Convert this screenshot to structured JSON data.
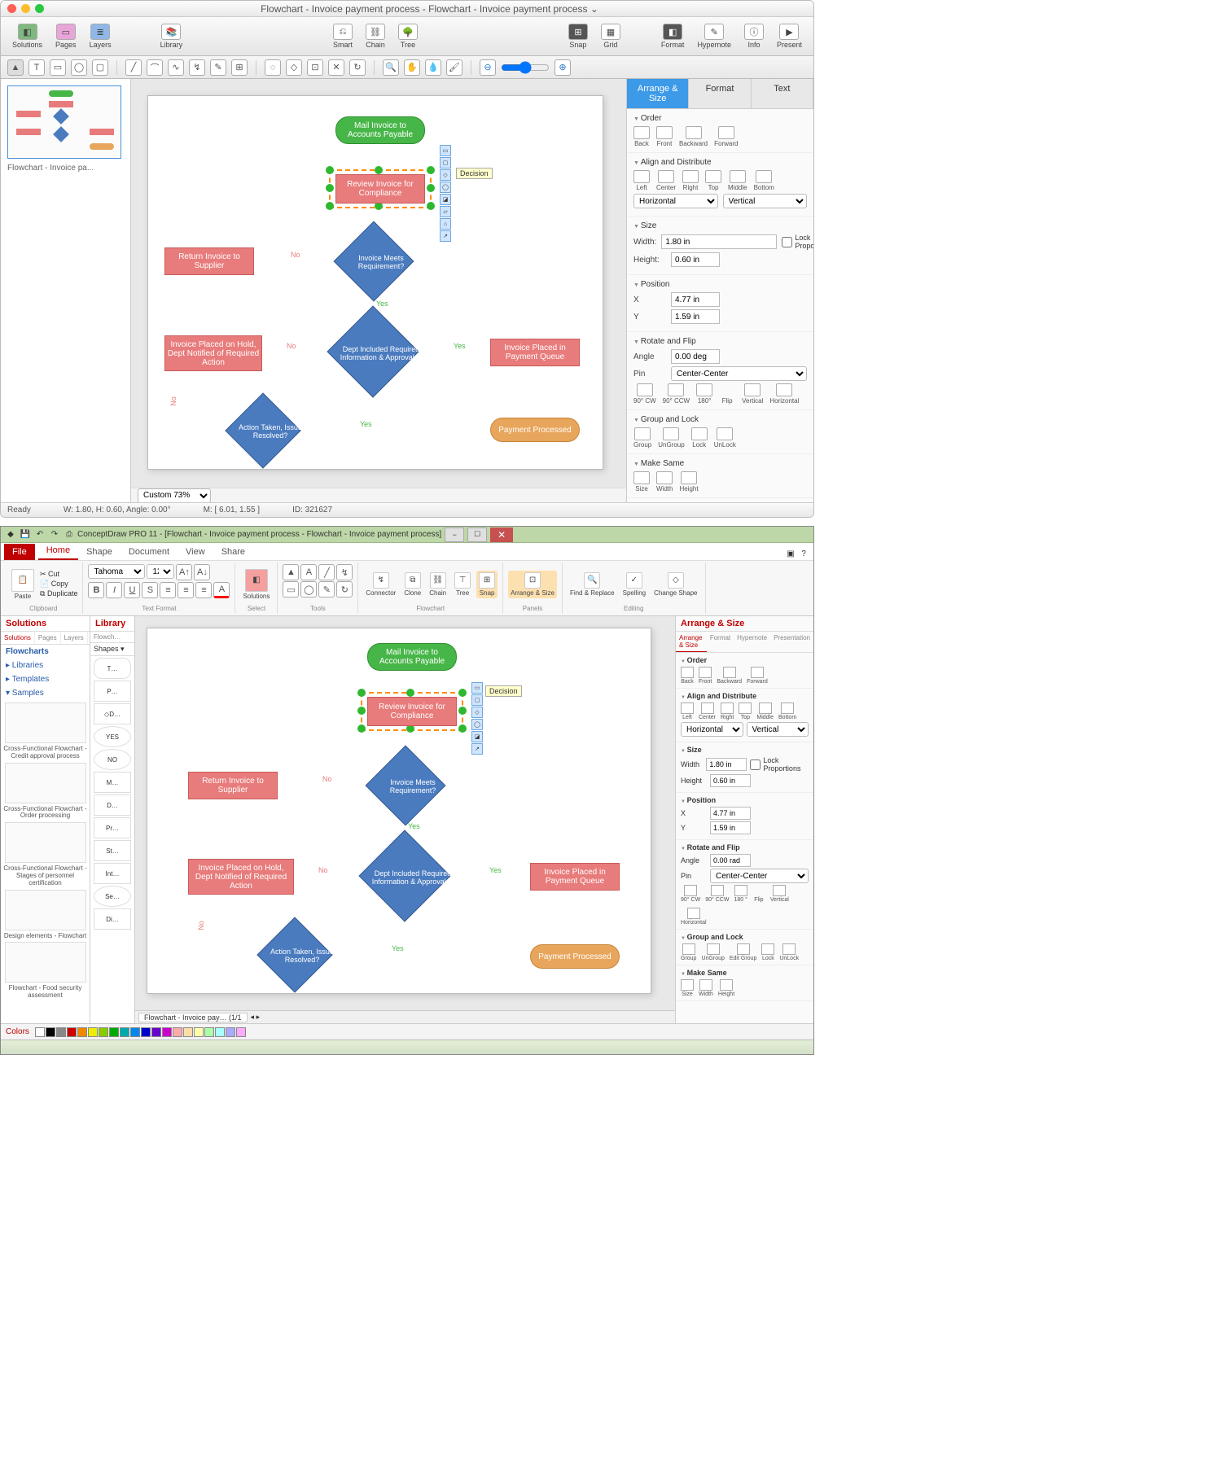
{
  "mac": {
    "title": "Flowchart - Invoice payment process - Flowchart - Invoice payment process ⌄",
    "toolbar": [
      "Solutions",
      "Pages",
      "Layers",
      "Library",
      "Smart",
      "Chain",
      "Tree",
      "Snap",
      "Grid",
      "Format",
      "Hypernote",
      "Info",
      "Present"
    ],
    "thumbTitle": "Flowchart - Invoice pa...",
    "tabs": {
      "arrange": "Arrange & Size",
      "format": "Format",
      "text": "Text"
    },
    "sections": {
      "order": {
        "h": "Order",
        "items": [
          "Back",
          "Front",
          "Backward",
          "Forward"
        ]
      },
      "align": {
        "h": "Align and Distribute",
        "items": [
          "Left",
          "Center",
          "Right",
          "Top",
          "Middle",
          "Bottom"
        ],
        "horiz": "Horizontal",
        "vert": "Vertical"
      },
      "size": {
        "h": "Size",
        "w": "Width:",
        "h_": "Height:",
        "wv": "1.80 in",
        "hv": "0.60 in",
        "lock": "Lock Proportions"
      },
      "pos": {
        "h": "Position",
        "x": "X",
        "y": "Y",
        "xv": "4.77 in",
        "yv": "1.59 in"
      },
      "rot": {
        "h": "Rotate and Flip",
        "a": "Angle",
        "av": "0.00 deg",
        "p": "Pin",
        "pv": "Center-Center",
        "items": [
          "90° CW",
          "90° CCW",
          "180°",
          "Flip",
          "Vertical",
          "Horizontal"
        ]
      },
      "grp": {
        "h": "Group and Lock",
        "items": [
          "Group",
          "UnGroup",
          "Lock",
          "UnLock"
        ]
      },
      "same": {
        "h": "Make Same",
        "items": [
          "Size",
          "Width",
          "Height"
        ]
      }
    },
    "zoom": "Custom 73%",
    "status": {
      "ready": "Ready",
      "wh": "W: 1.80,  H: 0.60,  Angle: 0.00°",
      "m": "M: [ 6.01, 1.55 ]",
      "id": "ID: 321627"
    },
    "tooltip": "Decision"
  },
  "win": {
    "title": "ConceptDraw PRO 11 - [Flowchart - Invoice payment process - Flowchart - Invoice payment process]",
    "ribbonTabs": [
      "File",
      "Home",
      "Shape",
      "Document",
      "View",
      "Share"
    ],
    "clipboard": {
      "paste": "Paste",
      "cut": "Cut",
      "copy": "Copy",
      "dup": "Duplicate",
      "grp": "Clipboard"
    },
    "font": {
      "name": "Tahoma",
      "size": "12",
      "grp": "Text Format"
    },
    "ribbonGroups": {
      "select": {
        "grp": "Select"
      },
      "tools": {
        "grp": "Tools"
      },
      "flowchart": {
        "items": [
          "Solutions",
          "Connector",
          "Clone",
          "Chain",
          "Tree",
          "Snap"
        ],
        "grp": "Flowchart"
      },
      "panels": {
        "items": [
          "Arrange & Size"
        ],
        "grp": "Panels"
      },
      "editing": {
        "items": [
          "Find & Replace",
          "Spelling",
          "Change Shape"
        ],
        "grp": "Editing"
      }
    },
    "leftHead": "Solutions",
    "libHead": "Library",
    "leftTabs": [
      "Solutions",
      "Pages",
      "Layers"
    ],
    "cats": [
      "Flowcharts",
      "▸ Libraries",
      "▸ Templates",
      "▾ Samples"
    ],
    "samples": [
      "Cross-Functional Flowchart - Credit approval process",
      "Cross-Functional Flowchart - Order processing",
      "Cross-Functional Flowchart - Stages of personnel certification",
      "Design elements - Flowchart",
      "Flowchart - Food security assessment"
    ],
    "shapesHead": "Shapes ▾",
    "shapes": [
      "T…",
      "P…",
      "D…",
      "YES",
      "NO",
      "M…",
      "D…",
      "Pr…",
      "St…",
      "Int…",
      "Se…",
      "Di…"
    ],
    "rightHead": "Arrange & Size",
    "rightTabs": [
      "Arrange & Size",
      "Format",
      "Hypernote",
      "Presentation"
    ],
    "tabName": "Flowchart - Invoice pay…  (1/1",
    "sections": {
      "order": {
        "h": "Order",
        "items": [
          "Back",
          "Front",
          "Backward",
          "Forward"
        ]
      },
      "align": {
        "h": "Align and Distribute",
        "items": [
          "Left",
          "Center",
          "Right",
          "Top",
          "Middle",
          "Bottom"
        ],
        "horiz": "Horizontal",
        "vert": "Vertical"
      },
      "size": {
        "h": "Size",
        "w": "Width",
        "h_": "Height",
        "wv": "1.80 in",
        "hv": "0.60 in",
        "lock": "Lock Proportions"
      },
      "pos": {
        "h": "Position",
        "x": "X",
        "y": "Y",
        "xv": "4.77 in",
        "yv": "1.59 in"
      },
      "rot": {
        "h": "Rotate and Flip",
        "a": "Angle",
        "av": "0.00 rad",
        "p": "Pin",
        "pv": "Center-Center",
        "items": [
          "90° CW",
          "90° CCW",
          "180 °",
          "Flip",
          "Vertical",
          "Horizontal"
        ]
      },
      "grp": {
        "h": "Group and Lock",
        "items": [
          "Group",
          "UnGroup",
          "Edit Group",
          "Lock",
          "UnLock"
        ]
      },
      "same": {
        "h": "Make Same",
        "items": [
          "Size",
          "Width",
          "Height"
        ]
      }
    },
    "tooltip": "Decision",
    "colors": "Colors"
  },
  "flow": {
    "mail": "Mail Invoice to Accounts Payable",
    "review": "Review Invoice for Compliance",
    "meets": "Invoice Meets Requirement?",
    "return": "Return Invoice to Supplier",
    "dept": "Dept Included Required Information & Approvals?",
    "hold": "Invoice Placed on Hold, Dept Notified of Required Action",
    "queue": "Invoice Placed in Payment Queue",
    "action": "Action Taken, Issue Resolved?",
    "pay": "Payment Processed",
    "yes": "Yes",
    "no": "No"
  }
}
